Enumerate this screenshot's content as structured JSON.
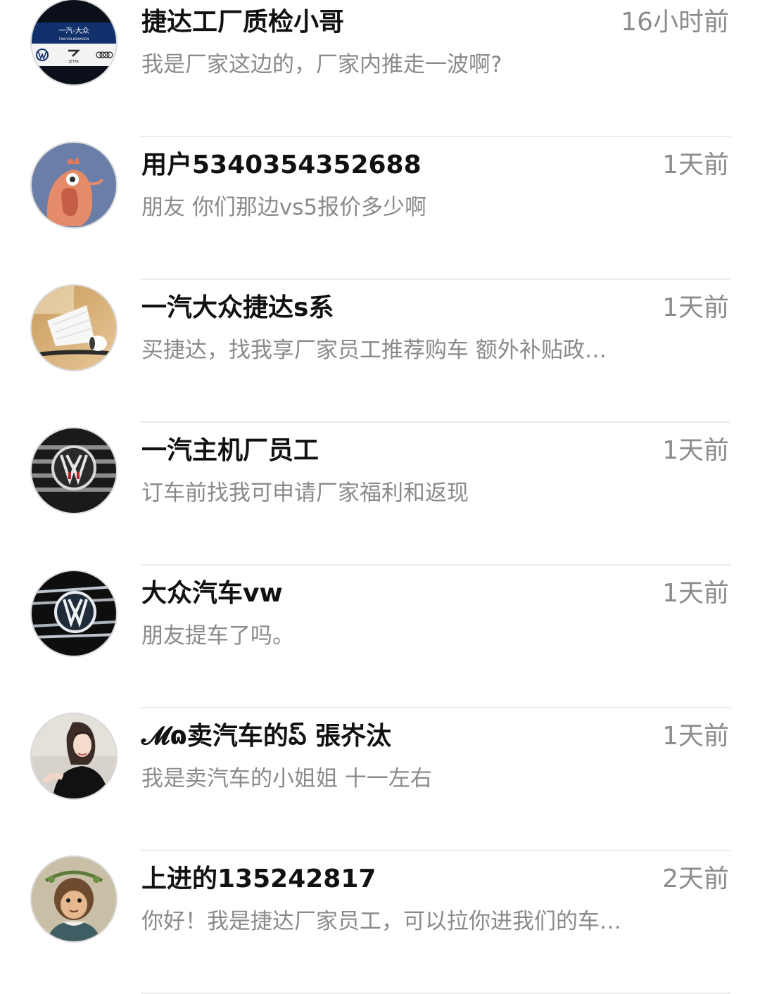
{
  "conversations": [
    {
      "name": "捷达工厂质检小哥",
      "time": "16小时前",
      "message": "我是厂家这边的，厂家内推走一波啊?",
      "avatar_icon": "faw-vw-jetta-logo-icon",
      "avatar_text": [
        "一汽-大众",
        "FAW-VOLKSWAGEN",
        "JETTA"
      ]
    },
    {
      "name": "用户5340354352688",
      "time": "1天前",
      "message": "朋友  你们那边vs5报价多少啊",
      "avatar_icon": "cartoon-bird-icon"
    },
    {
      "name": "一汽大众捷达s系",
      "time": "1天前",
      "message": "买捷达，找我享厂家员工推荐购车   额外补贴政策，点我头像私信我",
      "avatar_icon": "badminton-shuttlecock-icon"
    },
    {
      "name": "一汽主机厂员工",
      "time": "1天前",
      "message": "订车前找我可申请厂家福利和返现",
      "avatar_icon": "vw-grille-logo-icon"
    },
    {
      "name": "大众汽车vw",
      "time": "1天前",
      "message": "朋友提车了吗。",
      "avatar_icon": "vw-chrome-grille-icon"
    },
    {
      "name": "𝓜ɷ卖汽车的ప్ 張岕汰",
      "time": "1天前",
      "message": "我是卖汽车的小姐姐 十一左右",
      "avatar_icon": "woman-portrait-icon"
    },
    {
      "name": "上进的135242817",
      "time": "2天前",
      "message": "你好！我是捷达厂家员工，可以拉你进我们的车友群",
      "avatar_icon": "monkey-portrait-icon"
    }
  ]
}
